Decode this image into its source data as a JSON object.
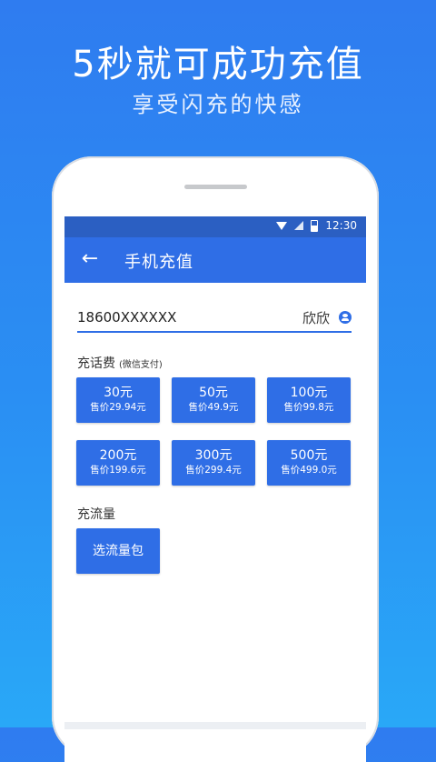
{
  "promo": {
    "headline": "5秒就可成功充值",
    "subline": "享受闪充的快感"
  },
  "status_bar": {
    "time": "12:30"
  },
  "app_bar": {
    "title": "手机充值"
  },
  "recharge": {
    "phone_number": "18600XXXXXX",
    "contact_name": "欣欣"
  },
  "phone_fee": {
    "title": "充话费",
    "note": "(微信支付)",
    "options": [
      {
        "face": "30元",
        "price": "售价29.94元"
      },
      {
        "face": "50元",
        "price": "售价49.9元"
      },
      {
        "face": "100元",
        "price": "售价99.8元"
      },
      {
        "face": "200元",
        "price": "售价199.6元"
      },
      {
        "face": "300元",
        "price": "售价299.4元"
      },
      {
        "face": "500元",
        "price": "售价499.0元"
      }
    ]
  },
  "data_plan": {
    "title": "充流量",
    "button": "选流量包"
  },
  "colors": {
    "primary": "#2f6ee6",
    "status_bar": "#2b5fc2",
    "background_top": "#2f7cf0",
    "background_bottom": "#29a8f7"
  }
}
